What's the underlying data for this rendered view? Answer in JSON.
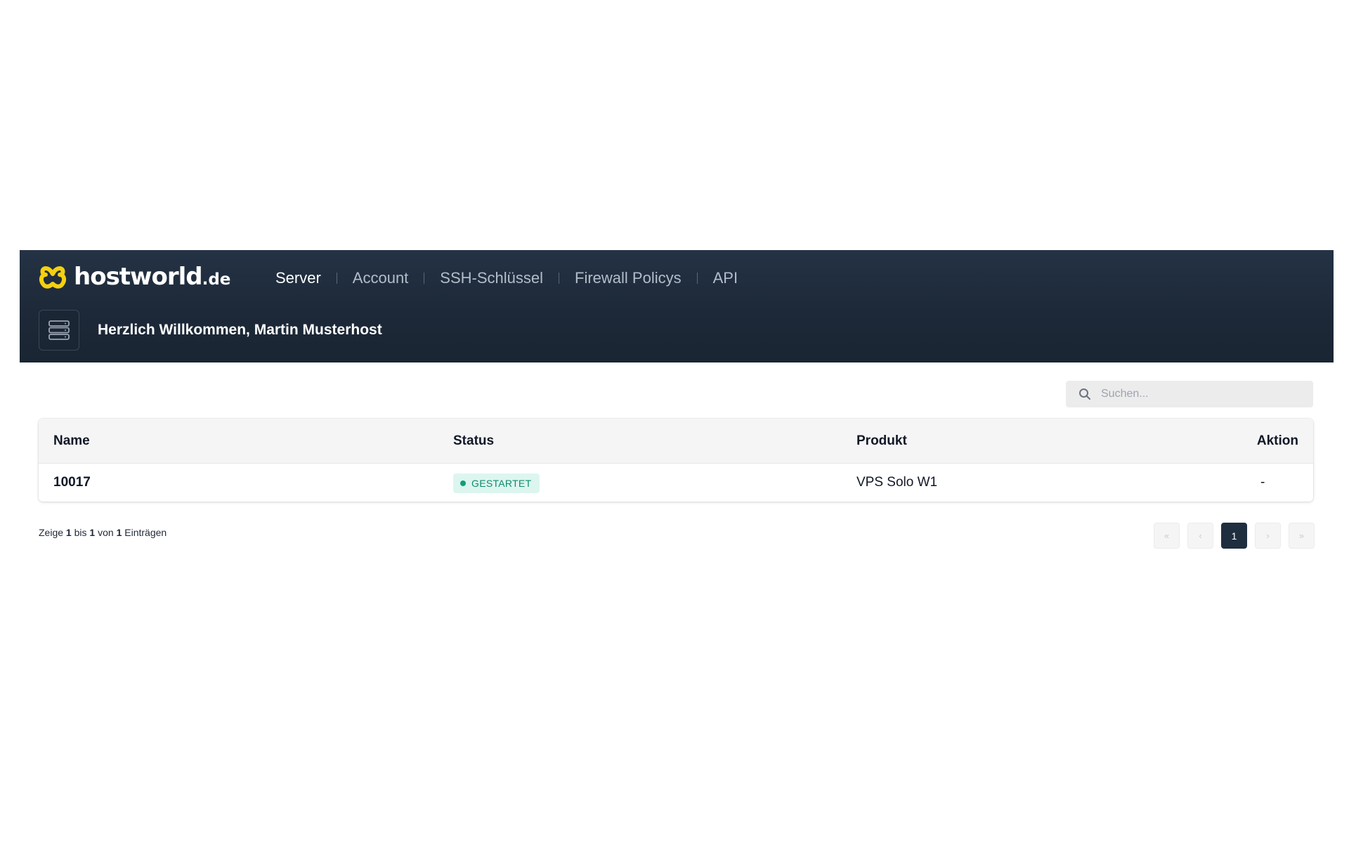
{
  "brand": {
    "name": "hostworld",
    "tld": ".de",
    "logo_color": "#f5d00f"
  },
  "nav": {
    "items": [
      {
        "label": "Server",
        "active": true
      },
      {
        "label": "Account",
        "active": false
      },
      {
        "label": "SSH-Schlüssel",
        "active": false
      },
      {
        "label": "Firewall Policys",
        "active": false
      },
      {
        "label": "API",
        "active": false
      }
    ]
  },
  "header": {
    "icon": "server-stack-icon",
    "welcome": "Herzlich Willkommen, Martin Musterhost"
  },
  "search": {
    "placeholder": "Suchen...",
    "value": "",
    "icon": "search-icon"
  },
  "table": {
    "columns": {
      "name": "Name",
      "status": "Status",
      "product": "Produkt",
      "action": "Aktion"
    },
    "rows": [
      {
        "name": "10017",
        "status": "GESTARTET",
        "product": "VPS Solo W1",
        "action": "-"
      }
    ]
  },
  "info": {
    "prefix": "Zeige",
    "from": "1",
    "bis": "bis",
    "to": "1",
    "von": "von",
    "total": "1",
    "suffix": "Einträgen"
  },
  "pagination": {
    "first": "«",
    "prev": "‹",
    "current": "1",
    "next": "›",
    "last": "»"
  },
  "colors": {
    "header_bg": "#1d2938",
    "status_bg": "#dcf6ef",
    "status_text": "#0f8a6c",
    "active_page_bg": "#1f2e3f"
  }
}
